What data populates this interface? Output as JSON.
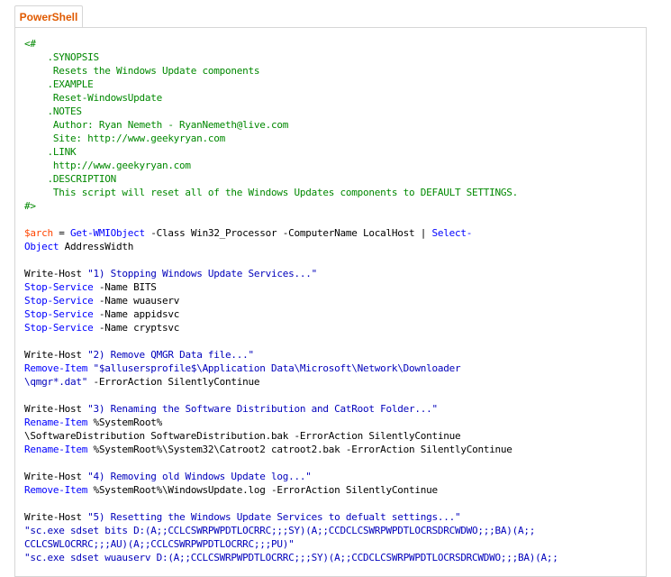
{
  "tab": {
    "label": "PowerShell"
  },
  "code": {
    "lines": [
      [
        {
          "t": "<#",
          "c": "cm"
        }
      ],
      [
        {
          "t": "    .SYNOPSIS",
          "c": "cm"
        }
      ],
      [
        {
          "t": "     Resets the Windows Update components",
          "c": "cm"
        }
      ],
      [
        {
          "t": "    .EXAMPLE",
          "c": "cm"
        }
      ],
      [
        {
          "t": "     Reset-WindowsUpdate",
          "c": "cm"
        }
      ],
      [
        {
          "t": "    .NOTES",
          "c": "cm"
        }
      ],
      [
        {
          "t": "     Author: Ryan Nemeth - RyanNemeth@live.com",
          "c": "cm"
        }
      ],
      [
        {
          "t": "     Site: http://www.geekyryan.com",
          "c": "cm"
        }
      ],
      [
        {
          "t": "    .LINK",
          "c": "cm"
        }
      ],
      [
        {
          "t": "     http://www.geekyryan.com",
          "c": "cm"
        }
      ],
      [
        {
          "t": "    .DESCRIPTION",
          "c": "cm"
        }
      ],
      [
        {
          "t": "     This script will reset all of the Windows Updates components to DEFAULT SETTINGS.",
          "c": "cm"
        }
      ],
      [
        {
          "t": "#>",
          "c": "cm"
        }
      ],
      [],
      [
        {
          "t": "$arch",
          "c": "v"
        },
        {
          "t": " = ",
          "c": "arg"
        },
        {
          "t": "Get-WMIObject",
          "c": "cmd"
        },
        {
          "t": " -Class Win32_Processor -ComputerName LocalHost ",
          "c": "arg"
        },
        {
          "t": "|",
          "c": "arg"
        },
        {
          "t": " ",
          "c": "arg"
        },
        {
          "t": "Select-",
          "c": "cmd"
        }
      ],
      [
        {
          "t": "Object",
          "c": "cmd"
        },
        {
          "t": " AddressWidth",
          "c": "arg"
        }
      ],
      [],
      [
        {
          "t": "Write-Host ",
          "c": "arg"
        },
        {
          "t": "\"1) Stopping Windows Update Services...\"",
          "c": "str"
        }
      ],
      [
        {
          "t": "Stop-Service",
          "c": "cmd"
        },
        {
          "t": " -Name BITS",
          "c": "arg"
        }
      ],
      [
        {
          "t": "Stop-Service",
          "c": "cmd"
        },
        {
          "t": " -Name wuauserv",
          "c": "arg"
        }
      ],
      [
        {
          "t": "Stop-Service",
          "c": "cmd"
        },
        {
          "t": " -Name appidsvc",
          "c": "arg"
        }
      ],
      [
        {
          "t": "Stop-Service",
          "c": "cmd"
        },
        {
          "t": " -Name cryptsvc",
          "c": "arg"
        }
      ],
      [],
      [
        {
          "t": "Write-Host ",
          "c": "arg"
        },
        {
          "t": "\"2) Remove QMGR Data file...\"",
          "c": "str"
        }
      ],
      [
        {
          "t": "Remove-Item",
          "c": "cmd"
        },
        {
          "t": " ",
          "c": "arg"
        },
        {
          "t": "\"$allusersprofile$\\Application Data\\Microsoft\\Network\\Downloader",
          "c": "str"
        }
      ],
      [
        {
          "t": "\\qmgr*.dat\"",
          "c": "str"
        },
        {
          "t": " -ErrorAction SilentlyContinue",
          "c": "arg"
        }
      ],
      [],
      [
        {
          "t": "Write-Host ",
          "c": "arg"
        },
        {
          "t": "\"3) Renaming the Software Distribution and CatRoot Folder...\"",
          "c": "str"
        }
      ],
      [
        {
          "t": "Rename-Item",
          "c": "cmd"
        },
        {
          "t": " %SystemRoot%",
          "c": "arg"
        }
      ],
      [
        {
          "t": "\\SoftwareDistribution SoftwareDistribution.bak -ErrorAction SilentlyContinue",
          "c": "arg"
        }
      ],
      [
        {
          "t": "Rename-Item",
          "c": "cmd"
        },
        {
          "t": " %SystemRoot%\\System32\\Catroot2 catroot2.bak -ErrorAction SilentlyContinue",
          "c": "arg"
        }
      ],
      [],
      [
        {
          "t": "Write-Host ",
          "c": "arg"
        },
        {
          "t": "\"4) Removing old Windows Update log...\"",
          "c": "str"
        }
      ],
      [
        {
          "t": "Remove-Item",
          "c": "cmd"
        },
        {
          "t": " %SystemRoot%\\WindowsUpdate.log -ErrorAction SilentlyContinue",
          "c": "arg"
        }
      ],
      [],
      [
        {
          "t": "Write-Host ",
          "c": "arg"
        },
        {
          "t": "\"5) Resetting the Windows Update Services to defualt settings...\"",
          "c": "str"
        }
      ],
      [
        {
          "t": "\"sc.exe sdset bits D:(A;;CCLCSWRPWPDTLOCRRC;;;SY)(A;;CCDCLCSWRPWPDTLOCRSDRCWDWO;;;BA)(A;;",
          "c": "str"
        }
      ],
      [
        {
          "t": "CCLCSWLOCRRC;;;AU)(A;;CCLCSWRPWPDTLOCRRC;;;PU)\"",
          "c": "str"
        }
      ],
      [
        {
          "t": "\"sc.exe sdset wuauserv D:(A;;CCLCSWRPWPDTLOCRRC;;;SY)(A;;CCDCLCSWRPWPDTLOCRSDRCWDWO;;;BA)(A;;",
          "c": "str"
        }
      ]
    ]
  }
}
